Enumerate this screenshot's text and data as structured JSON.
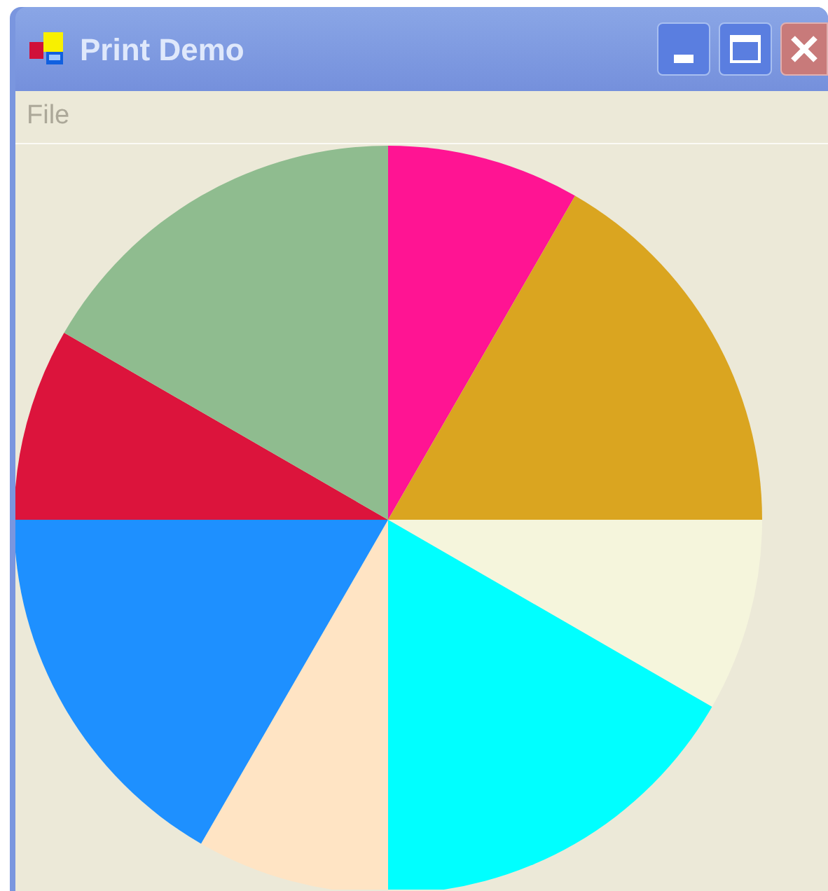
{
  "window": {
    "title": "Print Demo"
  },
  "menu": [
    {
      "label": "File",
      "disabled": true
    }
  ]
}
